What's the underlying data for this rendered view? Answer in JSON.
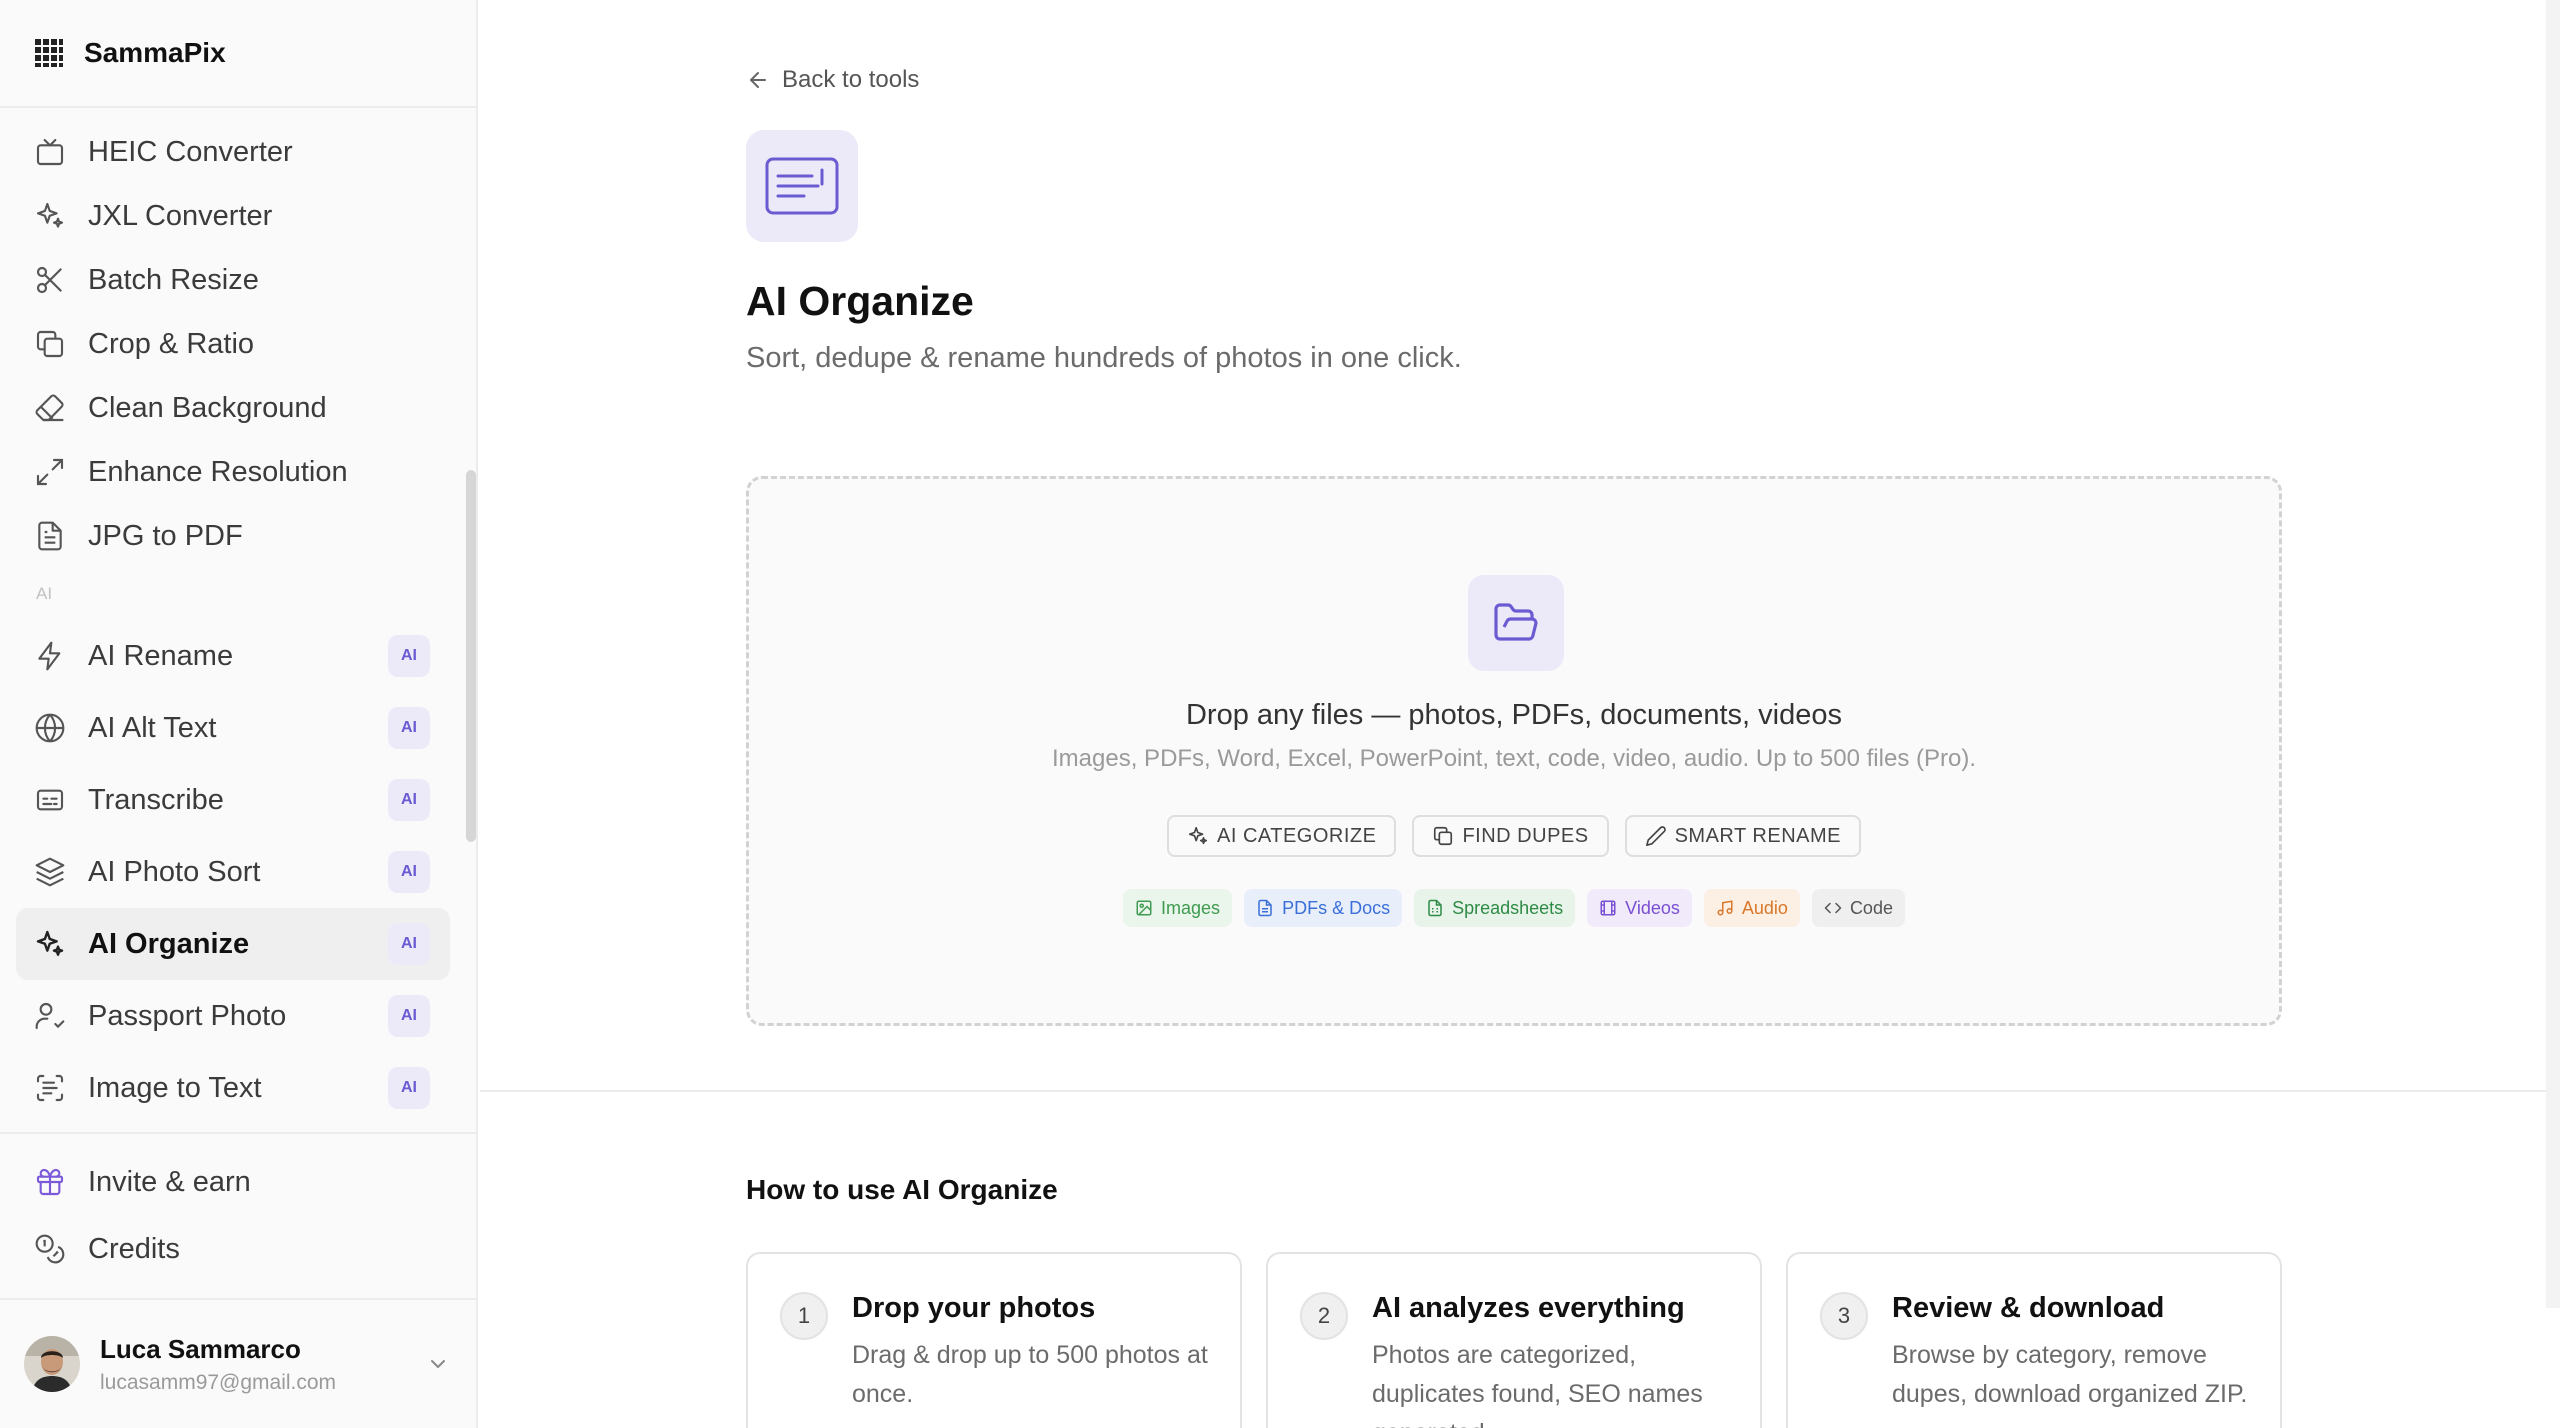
{
  "app": {
    "brand": "SammaPix"
  },
  "sidebar": {
    "tools": [
      {
        "label": "HEIC Converter",
        "icon": "tv-icon"
      },
      {
        "label": "JXL Converter",
        "icon": "sparkles-icon"
      },
      {
        "label": "Batch Resize",
        "icon": "scissors-icon"
      },
      {
        "label": "Crop & Ratio",
        "icon": "copy-icon"
      },
      {
        "label": "Clean Background",
        "icon": "eraser-icon"
      },
      {
        "label": "Enhance Resolution",
        "icon": "expand-icon"
      },
      {
        "label": "JPG to PDF",
        "icon": "file-text-icon"
      }
    ],
    "ai_section_label": "AI",
    "ai_tools": [
      {
        "label": "AI Rename",
        "icon": "zap-icon",
        "badge": "AI"
      },
      {
        "label": "AI Alt Text",
        "icon": "globe-icon",
        "badge": "AI"
      },
      {
        "label": "Transcribe",
        "icon": "captions-icon",
        "badge": "AI"
      },
      {
        "label": "AI Photo Sort",
        "icon": "layers-icon",
        "badge": "AI"
      },
      {
        "label": "AI Organize",
        "icon": "sparkles-icon",
        "badge": "AI",
        "active": true
      },
      {
        "label": "Passport Photo",
        "icon": "user-check-icon",
        "badge": "AI"
      },
      {
        "label": "Image to Text",
        "icon": "scan-text-icon",
        "badge": "AI"
      }
    ],
    "bottom": [
      {
        "label": "Invite & earn",
        "icon": "gift-icon"
      },
      {
        "label": "Credits",
        "icon": "coins-icon"
      }
    ],
    "user": {
      "name": "Luca Sammarco",
      "email": "lucasamm97@gmail.com"
    }
  },
  "main": {
    "back_label": "Back to tools",
    "title": "AI Organize",
    "subtitle": "Sort, dedupe & rename hundreds of photos in one click.",
    "dropzone": {
      "title": "Drop any files — photos, PDFs, documents, videos",
      "subtitle": "Images, PDFs, Word, Excel, PowerPoint, text, code, video, audio. Up to 500 files (Pro).",
      "actions": [
        "AI CATEGORIZE",
        "FIND DUPES",
        "SMART RENAME"
      ],
      "tags": [
        {
          "label": "Images",
          "color": "#3f9b4f",
          "bg": "#eaf5ec"
        },
        {
          "label": "PDFs & Docs",
          "color": "#3a6fd8",
          "bg": "#e8effb"
        },
        {
          "label": "Spreadsheets",
          "color": "#2e8b45",
          "bg": "#e8f4ea"
        },
        {
          "label": "Videos",
          "color": "#7a4fd1",
          "bg": "#f0eafb"
        },
        {
          "label": "Audio",
          "color": "#d9772a",
          "bg": "#fcefe4"
        },
        {
          "label": "Code",
          "color": "#555555",
          "bg": "#efefef"
        }
      ]
    },
    "how_title": "How to use AI Organize",
    "steps": [
      {
        "num": "1",
        "title": "Drop your photos",
        "text": "Drag & drop up to 500 photos at once."
      },
      {
        "num": "2",
        "title": "AI analyzes everything",
        "text": "Photos are categorized, duplicates found, SEO names generated."
      },
      {
        "num": "3",
        "title": "Review & download",
        "text": "Browse by category, remove dupes, download organized ZIP."
      }
    ]
  },
  "colors": {
    "accent": "#6b5bd2",
    "accent_bg": "#ece9f9"
  }
}
